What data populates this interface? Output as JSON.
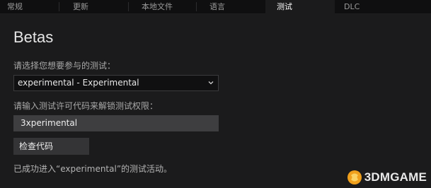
{
  "tabs": [
    {
      "label": "常规",
      "active": false
    },
    {
      "label": "更新",
      "active": false
    },
    {
      "label": "本地文件",
      "active": false
    },
    {
      "label": "语言",
      "active": false
    },
    {
      "label": "测试",
      "active": true
    },
    {
      "label": "DLC",
      "active": false
    }
  ],
  "betas": {
    "title": "Betas",
    "select_label": "请选择您想要参与的测试：",
    "selected_value": "experimental - Experimental",
    "code_label": "请输入测试许可代码来解锁测试权限：",
    "code_value": "3xperimental",
    "check_button": "检查代码",
    "status_text": "已成功进入“experimental”的测试活动。"
  },
  "watermark": {
    "text": "3DMGAME"
  },
  "colors": {
    "background": "#1b1b1c",
    "tabbar": "#0f0f10",
    "input_fill": "#3e3e40",
    "button_fill": "#343436"
  }
}
